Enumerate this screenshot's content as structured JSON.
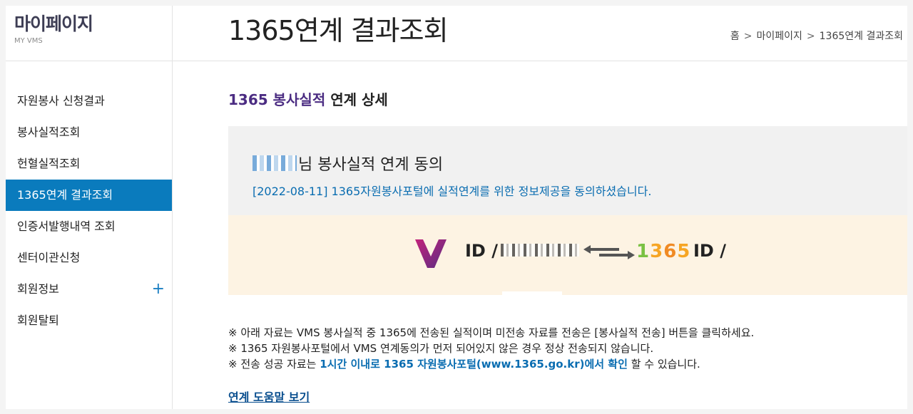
{
  "sidebar": {
    "title": "마이페이지",
    "subtitle": "MY VMS",
    "items": [
      {
        "label": "자원봉사 신청결과"
      },
      {
        "label": "봉사실적조회"
      },
      {
        "label": "헌혈실적조회"
      },
      {
        "label": "1365연계 결과조회"
      },
      {
        "label": "인증서발행내역 조회"
      },
      {
        "label": "센터이관신청"
      },
      {
        "label": "회원정보",
        "expand_icon": "+"
      },
      {
        "label": "회원탈퇴"
      }
    ],
    "active_index": 3
  },
  "header": {
    "title": "1365연계 결과조회",
    "breadcrumb": [
      "홈",
      "마이페이지",
      "1365연계 결과조회"
    ],
    "breadcrumb_separator": ">"
  },
  "section": {
    "title_accent": "1365 봉사실적",
    "title_rest": " 연계 상세"
  },
  "consent": {
    "name_suffix": "님 봉사실적 연계 동의",
    "date_text": "[2022-08-11] 1365자원봉사포털에 실적연계를 위한 정보제공을 동의하셨습니다."
  },
  "linkage": {
    "left_id_label": "ID /",
    "right_id_label": "ID /",
    "right_logo_text": "1365",
    "colors": {
      "v_logo": "#8e2a7b",
      "arrow": "#555555",
      "logo_green": "#7ac143",
      "logo_orange": "#f6a524"
    }
  },
  "notes": [
    {
      "text": "※ 아래 자료는 VMS 봉사실적 중 1365에 전송된 실적이며 미전송 자료를 전송은 [봉사실적 전송] 버튼을 클릭하세요."
    },
    {
      "text": "※ 1365 자원봉사포털에서 VMS 연계동의가 먼저 되어있지 않은 경우 정상 전송되지 않습니다."
    },
    {
      "prefix": "※ 전송 성공 자료는 ",
      "highlight": "1시간 이내로 1365 자원봉사포털(www.1365.go.kr)에서 확인",
      "suffix": " 할 수 있습니다."
    }
  ],
  "help_link": "연계 도움말 보기",
  "colors": {
    "active_menu": "#0a7bbd",
    "accent_purple": "#4b2c82",
    "link_blue": "#0a6db1",
    "consent_bg": "#f1f1f1",
    "linkage_bg": "#fdf3e3"
  }
}
